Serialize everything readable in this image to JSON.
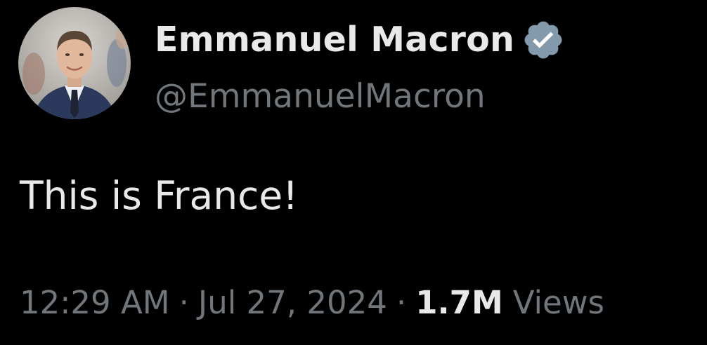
{
  "author": {
    "display_name": "Emmanuel Macron",
    "handle": "@EmmanuelMacron",
    "verified": true,
    "verified_badge_color": "#829aab",
    "avatar_icon": "profile-photo"
  },
  "tweet": {
    "text": "This is France!"
  },
  "meta": {
    "time": "12:29 AM",
    "separator": "·",
    "date": "Jul 27, 2024",
    "views_count": "1.7M",
    "views_label": "Views"
  },
  "colors": {
    "background": "#000000",
    "primary_text": "#e7e9ea",
    "secondary_text": "#71767b"
  }
}
